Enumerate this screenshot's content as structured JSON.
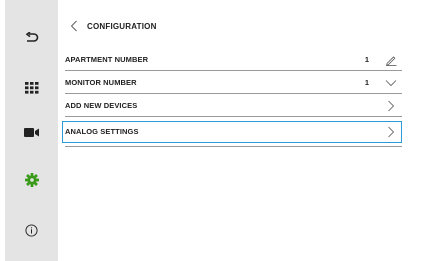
{
  "sidebar": {
    "items": [
      {
        "icon": "back-arrow-icon"
      },
      {
        "icon": "keypad-grid-icon"
      },
      {
        "icon": "camera-icon"
      },
      {
        "icon": "gear-icon",
        "active": true,
        "color": "#3a9a1a"
      },
      {
        "icon": "info-icon"
      }
    ]
  },
  "header": {
    "back_icon": "chevron-left-icon",
    "title": "CONFIGURATION"
  },
  "rows": [
    {
      "label": "APARTMENT NUMBER",
      "value": "1",
      "trail_icon": "pencil-icon"
    },
    {
      "label": "MONITOR NUMBER",
      "value": "1",
      "trail_icon": "chevron-down-icon"
    },
    {
      "label": "ADD NEW DEVICES",
      "value": "",
      "trail_icon": "chevron-right-icon"
    },
    {
      "label": "ANALOG SETTINGS",
      "value": "",
      "trail_icon": "chevron-right-icon",
      "selected": true
    }
  ],
  "colors": {
    "selection": "#2e9bd8",
    "active_icon": "#3a9a1a",
    "sidebar_bg": "#e4e4e4"
  }
}
